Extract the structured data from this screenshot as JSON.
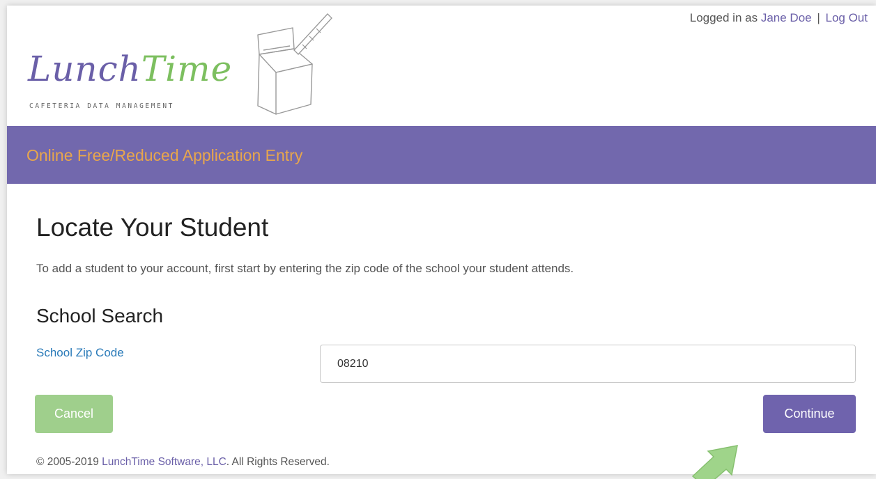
{
  "user_bar": {
    "prefix": "Logged in as ",
    "user_name": "Jane Doe",
    "separator": "|",
    "logout_label": "Log Out"
  },
  "logo": {
    "word_part1": "Lunch",
    "word_part2": "Time",
    "tagline": "CAFETERIA DATA MANAGEMENT"
  },
  "banner": {
    "title": "Online Free/Reduced Application Entry"
  },
  "main": {
    "heading": "Locate Your Student",
    "intro": "To add a student to your account, first start by entering the zip code of the school your student attends.",
    "section_heading": "School Search",
    "zip_label": "School Zip Code",
    "zip_value": "08210",
    "cancel_label": "Cancel",
    "continue_label": "Continue"
  },
  "footer": {
    "copyright_prefix": "© 2005-2019 ",
    "company_link": "LunchTime Software, LLC",
    "copyright_suffix": ". All Rights Reserved."
  },
  "colors": {
    "banner": "#7268ad",
    "banner_text": "#e8a64c",
    "brand_purple": "#6a5fa8",
    "brand_green": "#7cbf5f",
    "cancel_button": "#9fcf8c",
    "continue_button": "#6f63ad",
    "label_blue": "#2b7bb9"
  }
}
